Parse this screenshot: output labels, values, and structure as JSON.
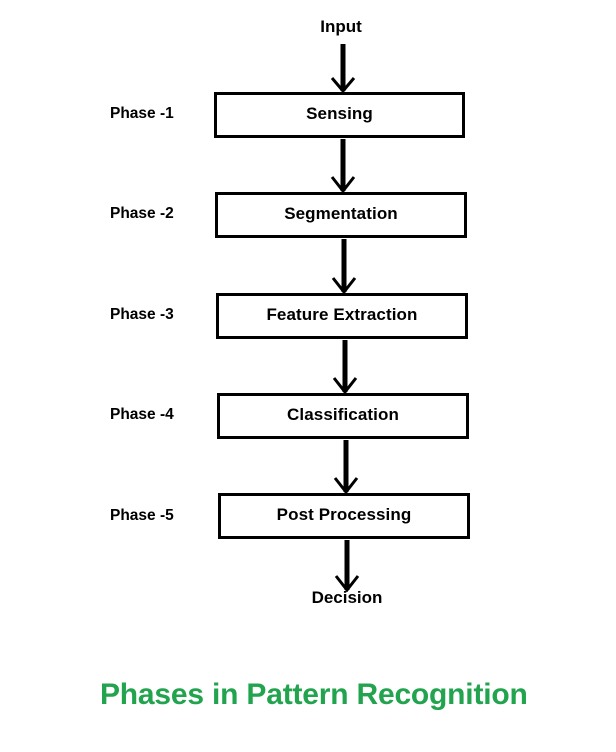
{
  "diagram": {
    "input_label": "Input",
    "output_label": "Decision",
    "caption": "Phases in Pattern Recognition",
    "caption_color": "#22a34e",
    "box_border_color": "#000000",
    "arrow_color": "#000000",
    "text_color": "#000000",
    "background_color": "#ffffff",
    "phases": [
      {
        "phase_label": "Phase -1",
        "box_label": "Sensing"
      },
      {
        "phase_label": "Phase -2",
        "box_label": "Segmentation"
      },
      {
        "phase_label": "Phase -3",
        "box_label": "Feature Extraction"
      },
      {
        "phase_label": "Phase -4",
        "box_label": "Classification"
      },
      {
        "phase_label": "Phase -5",
        "box_label": "Post Processing"
      }
    ],
    "arrows": [
      {
        "name": "input-to-sensing",
        "from": "Input",
        "to": "Sensing"
      },
      {
        "name": "sensing-to-segmentation",
        "from": "Sensing",
        "to": "Segmentation"
      },
      {
        "name": "segmentation-to-feature-extraction",
        "from": "Segmentation",
        "to": "Feature Extraction"
      },
      {
        "name": "feature-extraction-to-classification",
        "from": "Feature Extraction",
        "to": "Classification"
      },
      {
        "name": "classification-to-post-processing",
        "from": "Classification",
        "to": "Post Processing"
      },
      {
        "name": "post-processing-to-decision",
        "from": "Post Processing",
        "to": "Decision"
      }
    ]
  }
}
